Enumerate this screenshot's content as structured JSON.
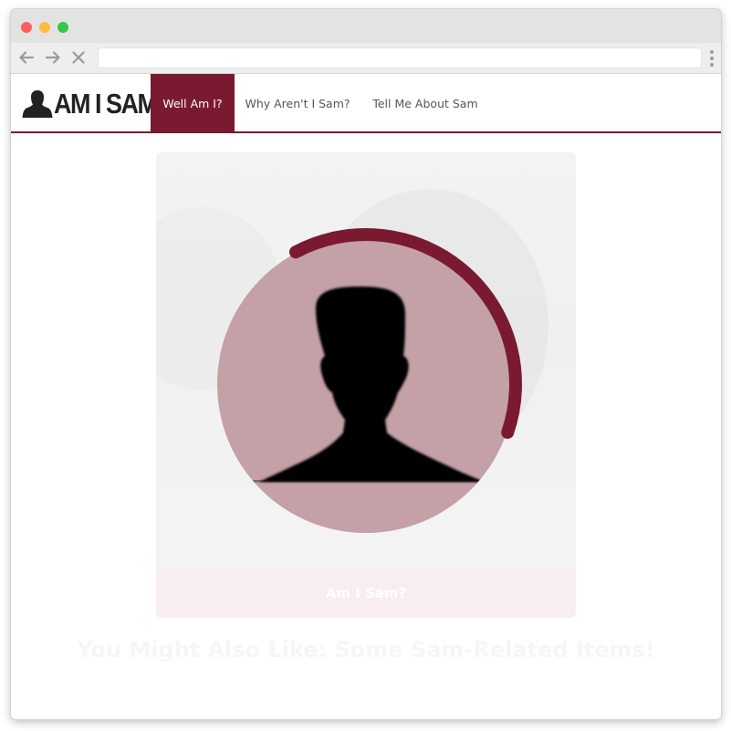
{
  "browser": {
    "traffic_lights": [
      "close",
      "minimize",
      "zoom"
    ],
    "colors": {
      "close": "#fc605c",
      "minimize": "#fdbc40",
      "zoom": "#34c84a"
    },
    "address_bar_value": ""
  },
  "site": {
    "logo_text": "AM I SAM",
    "brand_color": "#7a1a30",
    "nav": [
      {
        "label": "Well Am I?",
        "active": true
      },
      {
        "label": "Why Aren't I Sam?",
        "active": false
      },
      {
        "label": "Tell Me About Sam",
        "active": false
      }
    ]
  },
  "card": {
    "button_label": "Am I Sam?",
    "progress": 0.38,
    "avatar_icon": "person-silhouette-icon",
    "circle_color": "#c4a0a7"
  },
  "headline": "You Might Also Like: Some Sam-Related Items!"
}
